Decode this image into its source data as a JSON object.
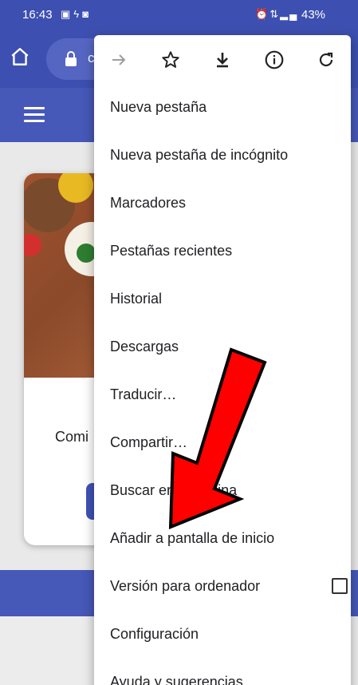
{
  "status_bar": {
    "time": "16:43",
    "left_icons": [
      "gallery-icon",
      "flash-icon",
      "cast-icon"
    ],
    "right_icons": [
      "alarm-icon",
      "data-icon",
      "signal-icon"
    ],
    "battery": "43%"
  },
  "toolbar": {
    "url_text": "c"
  },
  "menu": {
    "actions": [
      "forward-icon",
      "bookmark-star-icon",
      "download-icon",
      "info-icon",
      "refresh-icon"
    ],
    "items": [
      {
        "label": "Nueva pestaña"
      },
      {
        "label": "Nueva pestaña de incógnito"
      },
      {
        "label": "Marcadores"
      },
      {
        "label": "Pestañas recientes"
      },
      {
        "label": "Historial"
      },
      {
        "label": "Descargas"
      },
      {
        "label": "Traducir…"
      },
      {
        "label": "Compartir…"
      },
      {
        "label": "Buscar en la página"
      },
      {
        "label": "Añadir a pantalla de inicio"
      },
      {
        "label": "Versión para ordenador",
        "checked": false
      },
      {
        "label": "Configuración"
      },
      {
        "label": "Ayuda y sugerencias"
      }
    ]
  },
  "page": {
    "card_text": "Comi"
  },
  "annotation": {
    "arrow_color": "#ff0000"
  },
  "colors": {
    "brand": "#3d4fb0",
    "header": "#4658b8",
    "button": "#3f51b5"
  }
}
